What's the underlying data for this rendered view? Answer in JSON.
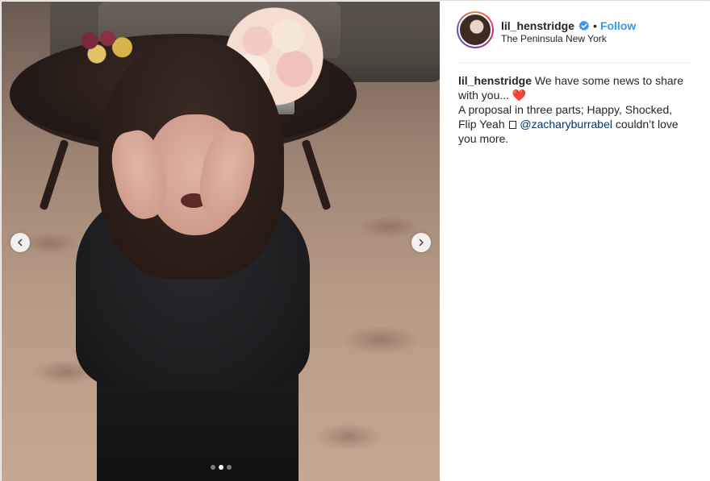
{
  "post": {
    "username": "lil_henstridge",
    "verified_icon": "verified-badge-icon",
    "separator": "•",
    "follow_label": "Follow",
    "location": "The Peninsula New York",
    "caption": {
      "username": "lil_henstridge",
      "line1": "We have some news to share with you...",
      "heart": "❤️",
      "line2": "A proposal in three parts; Happy, Shocked, Flip Yeah",
      "mention": "@zacharyburrabel",
      "line3": "couldn’t love you more."
    }
  },
  "carousel": {
    "prev_icon": "chevron-left-icon",
    "next_icon": "chevron-right-icon",
    "dots": [
      {
        "active": false
      },
      {
        "active": true
      },
      {
        "active": false
      }
    ]
  },
  "colors": {
    "follow": "#3897f0",
    "mention": "#003569",
    "text": "#262626",
    "border": "#dbdbdb"
  }
}
